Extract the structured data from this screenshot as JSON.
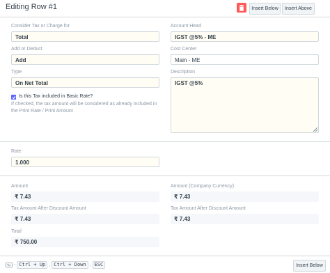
{
  "header": {
    "title": "Editing Row #1",
    "insert_below_label": "Insert Below",
    "insert_above_label": "Insert Above"
  },
  "form": {
    "charge_type": {
      "label": "Consider Tax or Charge for",
      "value": "Total"
    },
    "add_deduct": {
      "label": "Add or Deduct",
      "value": "Add"
    },
    "type": {
      "label": "Type",
      "value": "On Net Total"
    },
    "included_in_rate": {
      "label": "Is this Tax included in Basic Rate?",
      "checked": true,
      "help_line1": "If checked, the tax amount will be considered as already included in",
      "help_line2": "the Print Rate / Print Amount"
    },
    "account_head": {
      "label": "Account Head",
      "value": "IGST @5% - ME"
    },
    "cost_center": {
      "label": "Cost Center",
      "value": "Main - ME"
    },
    "description": {
      "label": "Description",
      "value": "IGST @5%"
    },
    "rate": {
      "label": "Rate",
      "value": "1.000"
    },
    "amount": {
      "label": "Amount",
      "value": "₹ 7.43"
    },
    "amount_company": {
      "label": "Amount (Company Currency)",
      "value": "₹ 7.43"
    },
    "tax_after_discount": {
      "label": "Tax Amount After Discount Amount",
      "value": "₹ 7.43"
    },
    "tax_after_discount_company": {
      "label": "Tax Amount After Discount Amount",
      "value": "₹ 7.43"
    },
    "total": {
      "label": "Total",
      "value": "₹ 750.00"
    }
  },
  "footer": {
    "shortcut_up": "Ctrl + Up",
    "shortcut_down": "Ctrl + Down",
    "shortcut_esc": "ESC",
    "sep1": "-",
    "sep2": ",",
    "sep3": ",",
    "insert_below_label": "Insert Below"
  },
  "colors": {
    "accent": "#5e64ff",
    "danger": "#ff5858",
    "input_bg": "#fffdf4"
  }
}
